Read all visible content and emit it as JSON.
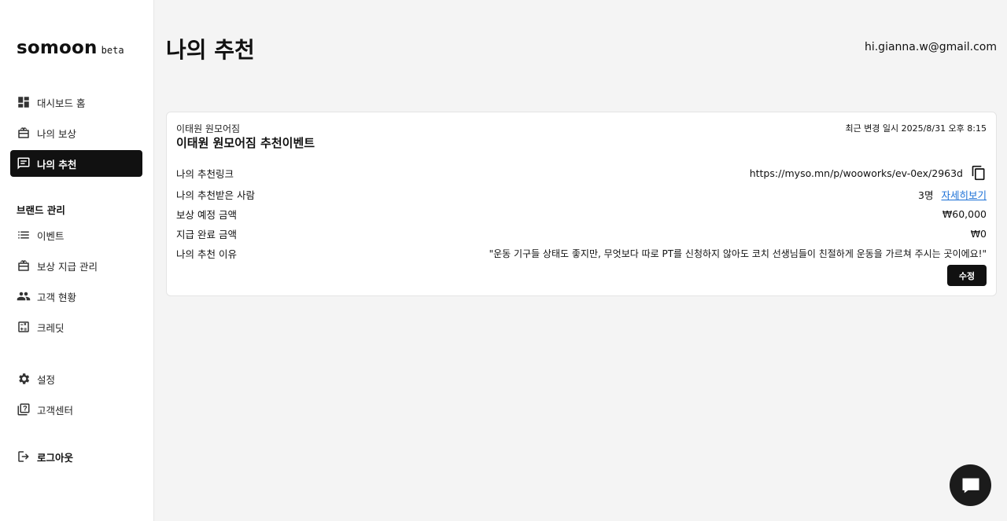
{
  "brand": {
    "name": "somoon",
    "badge": "beta"
  },
  "sidebar": {
    "items": [
      {
        "label": "대시보드 홈",
        "icon": "dashboard-icon"
      },
      {
        "label": "나의 보상",
        "icon": "reward-icon"
      },
      {
        "label": "나의 추천",
        "icon": "chat-icon",
        "active": true
      }
    ],
    "section_label": "브랜드 관리",
    "brand_items": [
      {
        "label": "이벤트",
        "icon": "list-icon"
      },
      {
        "label": "보상 지급 관리",
        "icon": "gift-icon"
      },
      {
        "label": "고객 현황",
        "icon": "people-icon"
      },
      {
        "label": "크레딧",
        "icon": "calculator-icon"
      }
    ],
    "bottom_items": [
      {
        "label": "설정",
        "icon": "gear-icon"
      },
      {
        "label": "고객센터",
        "icon": "help-icon"
      }
    ],
    "logout": {
      "label": "로그아웃",
      "icon": "logout-icon"
    }
  },
  "header": {
    "title": "나의 추천",
    "email": "hi.gianna.w@gmail.com"
  },
  "card": {
    "brand": "이태원 원모어짐",
    "title": "이태원 원모어짐 추천이벤트",
    "updated": "최근 변경 일시 2025/8/31 오후 8:15",
    "rows": {
      "link": {
        "label": "나의 추천링크",
        "value": "https://myso.mn/p/wooworks/ev-0ex/2963d"
      },
      "referred": {
        "label": "나의 추천받은 사람",
        "value": "3명",
        "link_text": "자세히보기"
      },
      "expected": {
        "label": "보상 예정 금액",
        "value": "₩60,000"
      },
      "paid": {
        "label": "지급 완료 금액",
        "value": "₩0"
      },
      "reason": {
        "label": "나의 추천 이유",
        "value": "\"운동 기구들 상태도 좋지만, 무엇보다 따로 PT를 신청하지 않아도 코치 선생님들이 친절하게 운동을 가르쳐 주시는 곳이에요!\""
      }
    },
    "edit_label": "수정"
  },
  "fab": {
    "icon": "chat-bubble-icon"
  }
}
